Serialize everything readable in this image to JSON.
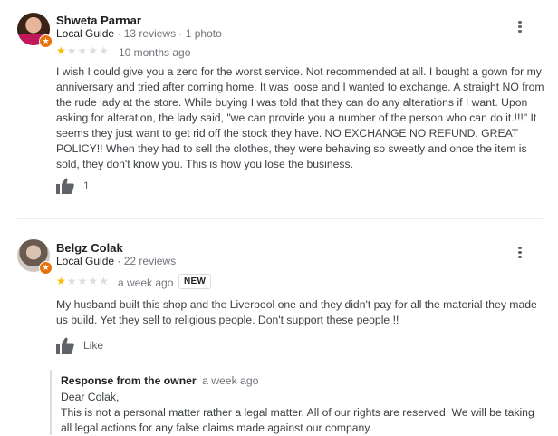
{
  "reviews": [
    {
      "author": "Shweta Parmar",
      "local_guide": "Local Guide",
      "stats": "· 13 reviews · 1 photo",
      "rating": 1,
      "date": "10 months ago",
      "text": "I wish I could give you a zero for the worst service. Not recommended at all. I bought a gown for my anniversary and tried after coming home. It was loose and I wanted to exchange. A straight NO from the rude lady at the store. While buying I was told that they can do any alterations if I want. Upon asking for alteration, the lady said, \"we can provide you a number of the person who can do it.!!!\" It seems they just want to get rid off the stock they have. NO EXCHANGE NO REFUND. GREAT POLICY!! When they had to sell the clothes, they were behaving so sweetly and once the item is sold, they don't know you. This is how you lose the business.",
      "like_label": "1"
    },
    {
      "author": "Belgz Colak",
      "local_guide": "Local Guide",
      "stats": "· 22 reviews",
      "rating": 1,
      "date": "a week ago",
      "badge": "NEW",
      "text": "My husband built this shop and the Liverpool one and they didn't pay for all the material they made us build. Yet they sell to religious people. Don't support these people !!",
      "like_label": "Like",
      "owner_response": {
        "title": "Response from the owner",
        "date": "a week ago",
        "greeting": "Dear Colak,",
        "text": "This is not a personal matter rather a legal matter. All of our rights are reserved. We will be taking all legal actions for any false claims made against our company."
      }
    }
  ],
  "icons": {
    "more": "more-vert-icon",
    "like": "thumb-up-icon",
    "local_guide": "local-guide-badge-icon"
  },
  "colors": {
    "star": "#fbbc04",
    "star_empty": "#dadce0",
    "badge": "#e8710a"
  }
}
